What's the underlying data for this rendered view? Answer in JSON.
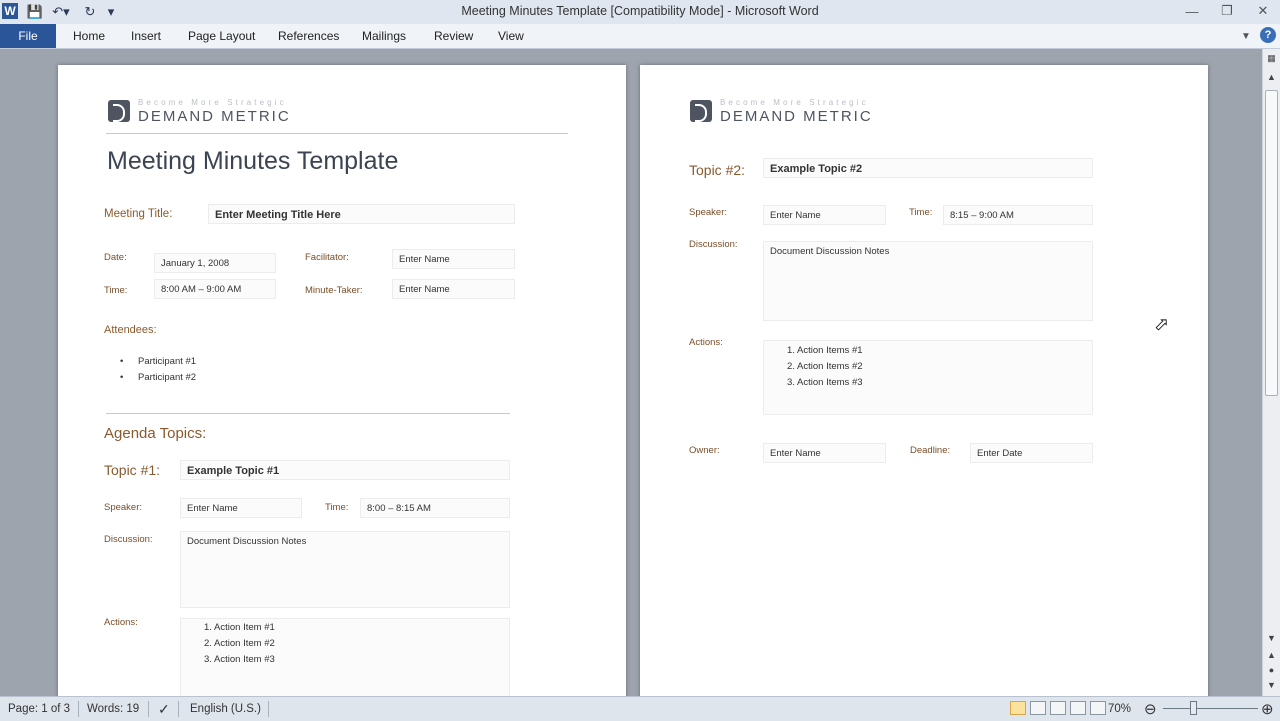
{
  "window": {
    "title": "Meeting Minutes Template [Compatibility Mode] - Microsoft Word",
    "app_icon_letter": "W",
    "quick_access": [
      "save-icon",
      "undo-icon",
      "redo-icon",
      "customize-icon"
    ],
    "controls": [
      "minimize-icon",
      "restore-icon",
      "close-icon"
    ]
  },
  "ribbon": {
    "file": "File",
    "tabs": [
      "Home",
      "Insert",
      "Page Layout",
      "References",
      "Mailings",
      "Review",
      "View"
    ]
  },
  "logo": {
    "tagline": "Become More Strategic",
    "name": "DEMAND METRIC"
  },
  "page1": {
    "title": "Meeting Minutes Template",
    "meeting_title_label": "Meeting Title:",
    "meeting_title_value": "Enter Meeting Title Here",
    "date_label": "Date:",
    "date_value": "January 1, 2008",
    "facilitator_label": "Facilitator:",
    "facilitator_value": "Enter Name",
    "time_label": "Time:",
    "time_value": "8:00 AM – 9:00 AM",
    "minute_taker_label": "Minute-Taker:",
    "minute_taker_value": "Enter Name",
    "attendees_label": "Attendees:",
    "attendees": [
      "Participant #1",
      "Participant #2"
    ],
    "agenda_label": "Agenda Topics:",
    "topic_label": "Topic #1:",
    "topic_value": "Example Topic #1",
    "speaker_label": "Speaker:",
    "speaker_value": "Enter Name",
    "topic_time_label": "Time:",
    "topic_time_value": "8:00 – 8:15 AM",
    "discussion_label": "Discussion:",
    "discussion_value": "Document  Discussion  Notes",
    "actions_label": "Actions:",
    "actions": [
      "1.    Action Item #1",
      "2.    Action Item #2",
      "3.    Action Item #3"
    ]
  },
  "page2": {
    "topic_label": "Topic #2:",
    "topic_value": "Example Topic #2",
    "speaker_label": "Speaker:",
    "speaker_value": "Enter Name",
    "time_label": "Time:",
    "time_value": "8:15 – 9:00 AM",
    "discussion_label": "Discussion:",
    "discussion_value": "Document  Discussion  Notes",
    "actions_label": "Actions:",
    "actions": [
      "1.    Action Items #1",
      "2.    Action Items #2",
      "3.    Action Items #3"
    ],
    "owner_label": "Owner:",
    "owner_value": "Enter Name",
    "deadline_label": "Deadline:",
    "deadline_value": "Enter Date"
  },
  "status": {
    "page": "Page: 1 of 3",
    "words": "Words: 19",
    "language": "English (U.S.)",
    "zoom": "70%",
    "zoom_level_percent": 70
  }
}
